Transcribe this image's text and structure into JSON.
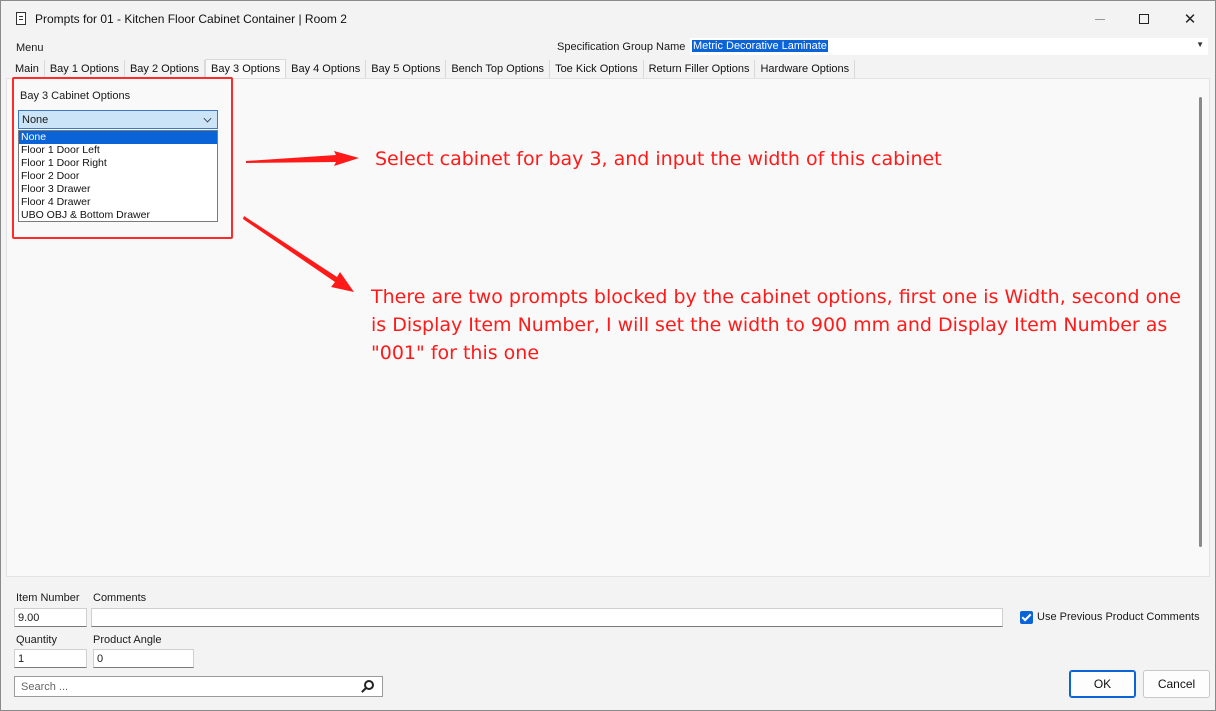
{
  "window": {
    "title": "Prompts for 01 - Kitchen Floor Cabinet Container | Room 2"
  },
  "menu": {
    "label": "Menu"
  },
  "spec_group": {
    "label": "Specification Group Name",
    "value": "Metric Decorative Laminate"
  },
  "tabs": [
    {
      "label": "Main"
    },
    {
      "label": "Bay 1 Options"
    },
    {
      "label": "Bay 2 Options"
    },
    {
      "label": "Bay 3 Options"
    },
    {
      "label": "Bay 4 Options"
    },
    {
      "label": "Bay 5 Options"
    },
    {
      "label": "Bench Top Options"
    },
    {
      "label": "Toe Kick Options"
    },
    {
      "label": "Return Filler Options"
    },
    {
      "label": "Hardware Options"
    }
  ],
  "active_tab": "Bay 3 Options",
  "bay3": {
    "label": "Bay 3 Cabinet Options",
    "selected": "None",
    "options": [
      "None",
      "Floor 1 Door Left",
      "Floor 1 Door Right",
      "Floor 2 Door",
      "Floor 3 Drawer",
      "Floor 4 Drawer",
      "UBO OBJ & Bottom Drawer"
    ]
  },
  "annotations": {
    "note1": "Select cabinet for bay 3, and input the width of this cabinet",
    "note2": "There are two prompts blocked by the cabinet options, first one is Width, second one is Display Item Number, I will set the width to 900 mm and Display Item Number as \"001\" for this one",
    "color": "#ff1a1a"
  },
  "bottom": {
    "item_number_label": "Item Number",
    "item_number_value": "9.00",
    "comments_label": "Comments",
    "comments_value": "",
    "use_prev_comments_label": "Use Previous Product Comments",
    "use_prev_comments_checked": true,
    "quantity_label": "Quantity",
    "quantity_value": "1",
    "product_angle_label": "Product Angle",
    "product_angle_value": "0",
    "search_placeholder": "Search ...",
    "ok_label": "OK",
    "cancel_label": "Cancel"
  },
  "colors": {
    "accent": "#0a64d8",
    "annotation_red": "#ff2a2a"
  }
}
